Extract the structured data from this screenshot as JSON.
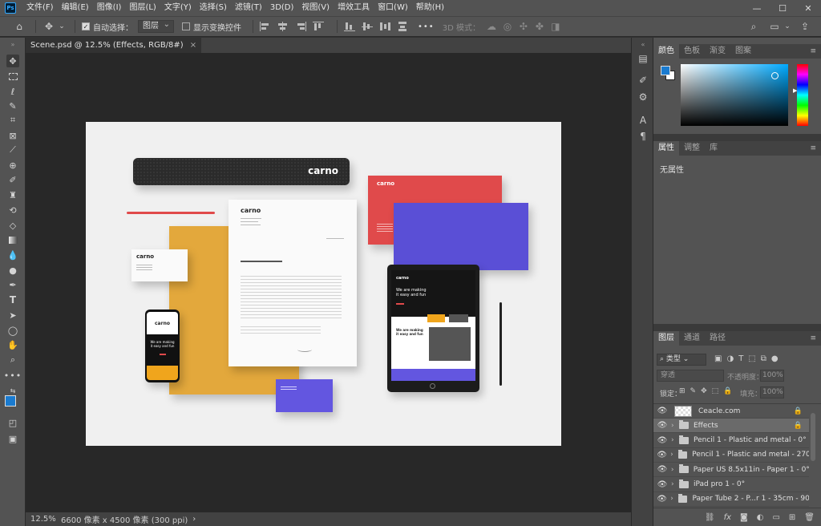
{
  "app": {
    "logo": "Ps",
    "menus": [
      "文件(F)",
      "编辑(E)",
      "图像(I)",
      "图层(L)",
      "文字(Y)",
      "选择(S)",
      "滤镜(T)",
      "3D(D)",
      "视图(V)",
      "增效工具",
      "窗口(W)",
      "帮助(H)"
    ],
    "window_controls": [
      "—",
      "☐",
      "✕"
    ]
  },
  "options": {
    "auto_select_label": "自动选择：",
    "auto_select_value": "图层",
    "show_transform_label": "显示变换控件",
    "more": "•••",
    "mode_3d_label": "3D 模式："
  },
  "document": {
    "tab_title": "Scene.psd @ 12.5% (Effects, RGB/8#)",
    "close": "×"
  },
  "mockup": {
    "tube_brand": "carno",
    "letter_brand": "carno",
    "envelope_brand": "carno",
    "card_brand": "carno",
    "phone_brand": "carno",
    "phone_headline": "We are making it easy and fun",
    "tablet_brand": "carno",
    "tablet_headline": "We are making it easy and fun",
    "tablet_sub_headline": "We are making it easy and fun"
  },
  "status": {
    "zoom": "12.5%",
    "doc_size": "6600 像素 x 4500 像素 (300 ppi)",
    "arrow": "›"
  },
  "panels": {
    "color_tabs": [
      "颜色",
      "色板",
      "渐变",
      "图案"
    ],
    "properties_tabs": [
      "属性",
      "调整",
      "库"
    ],
    "properties_empty": "无属性",
    "layers_tabs": [
      "图层",
      "通道",
      "路径"
    ],
    "filter_label": "类型",
    "blend_mode": "穿透",
    "opacity_label": "不透明度：",
    "opacity_value": "100%",
    "lock_label": "锁定：",
    "fill_label": "填充：",
    "fill_value": "100%",
    "layers": [
      {
        "name": "Ceacle.com",
        "type": "layer",
        "locked": true
      },
      {
        "name": "Effects",
        "type": "group",
        "locked": true,
        "selected": true
      },
      {
        "name": "Pencil 1 - Plastic and metal - 0°",
        "type": "group"
      },
      {
        "name": "Pencil 1 - Plastic and metal - 270°",
        "type": "group"
      },
      {
        "name": "Paper US 8.5x11in - Paper 1 - 0°",
        "type": "group"
      },
      {
        "name": "iPad pro 1 - 0°",
        "type": "group"
      },
      {
        "name": "Paper Tube 2 - P...r 1 - 35cm - 90°",
        "type": "group"
      }
    ],
    "layer_footer_icons": [
      "link-icon",
      "fx-icon",
      "mask-icon",
      "adjustment-icon",
      "folder-icon",
      "new-layer-icon",
      "trash-icon"
    ]
  },
  "colors": {
    "foreground": "#1a7bd0",
    "background": "#ffffff",
    "envelope_red": "#e04a4b",
    "envelope_blue": "#5a4fd6",
    "paper_yellow": "#e3a83c",
    "phone_button": "#f0a51c",
    "tablet_purple": "#6356e0",
    "pencil_red": "#e04a4b"
  }
}
